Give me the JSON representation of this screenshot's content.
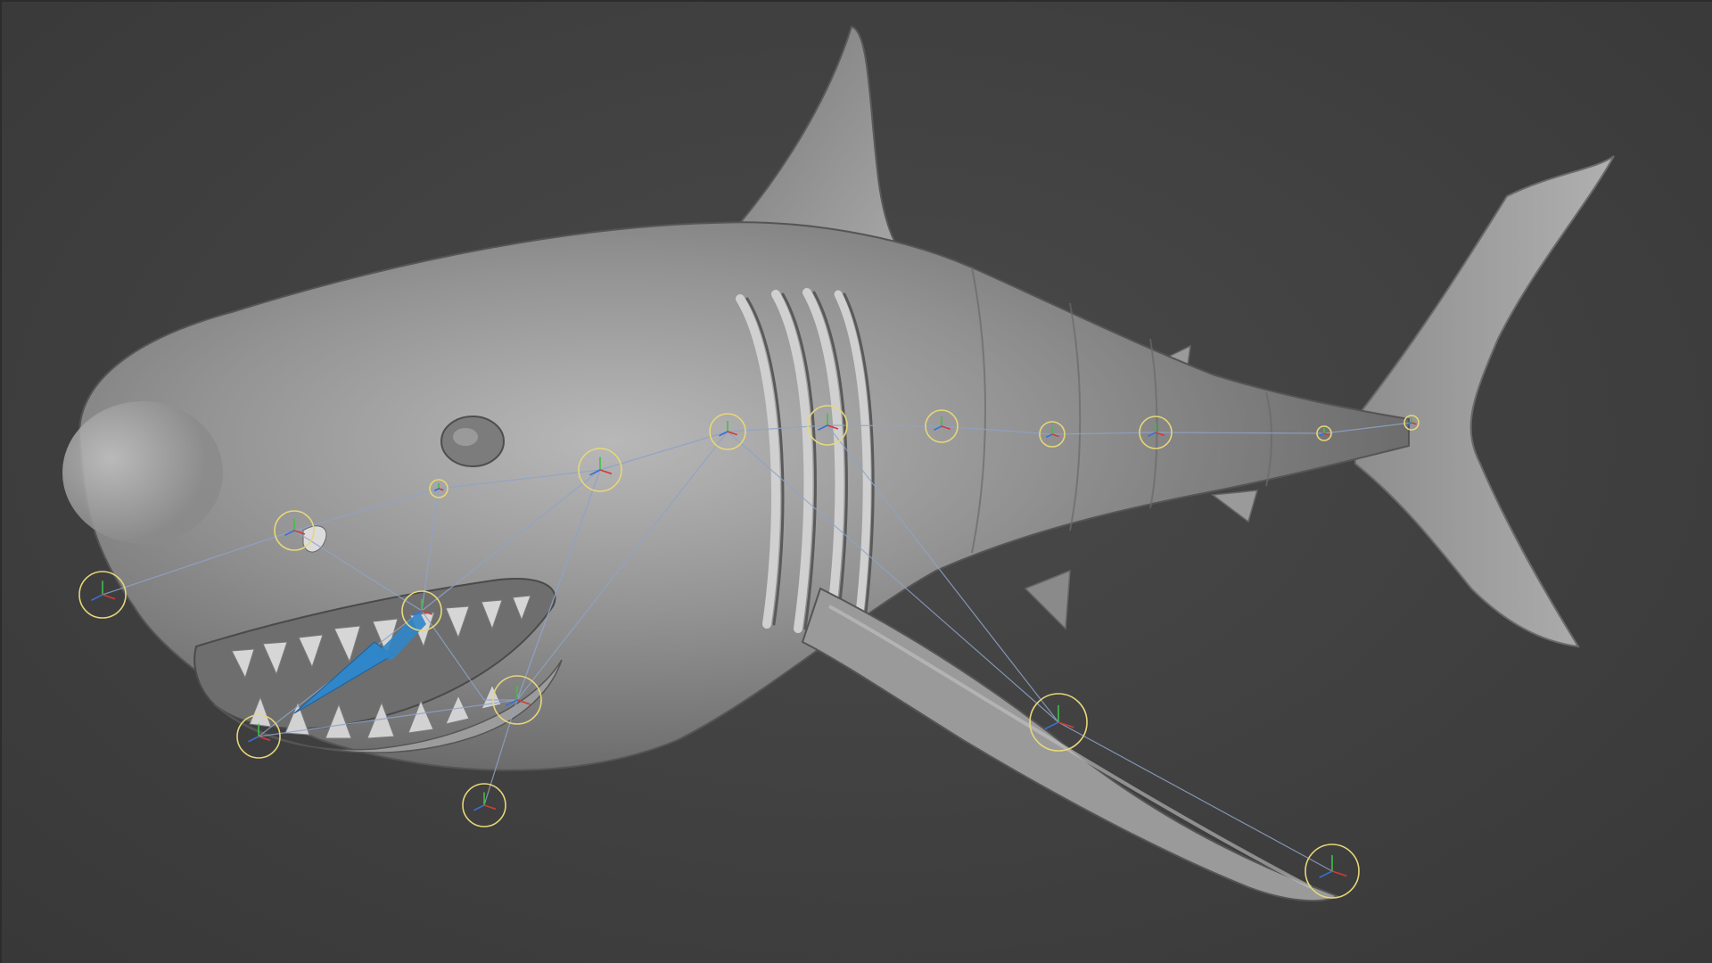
{
  "viewport": {
    "background": "#424242",
    "model_name": "shark",
    "shading": "gray-clay"
  },
  "colors": {
    "body_light": "#b4b4b4",
    "body_mid": "#8e8e8e",
    "body_dark": "#5c5c5c",
    "joint_ring": "#e6d77a",
    "bone_line": "#8fa3c9",
    "selected_bone": "#2f86c9",
    "axis_x": "#d23a3a",
    "axis_y": "#3fbf4a",
    "axis_z": "#3a6fd2"
  },
  "icons": {
    "joint": "joint-gizmo-icon",
    "selected": "selected-bone-icon"
  }
}
